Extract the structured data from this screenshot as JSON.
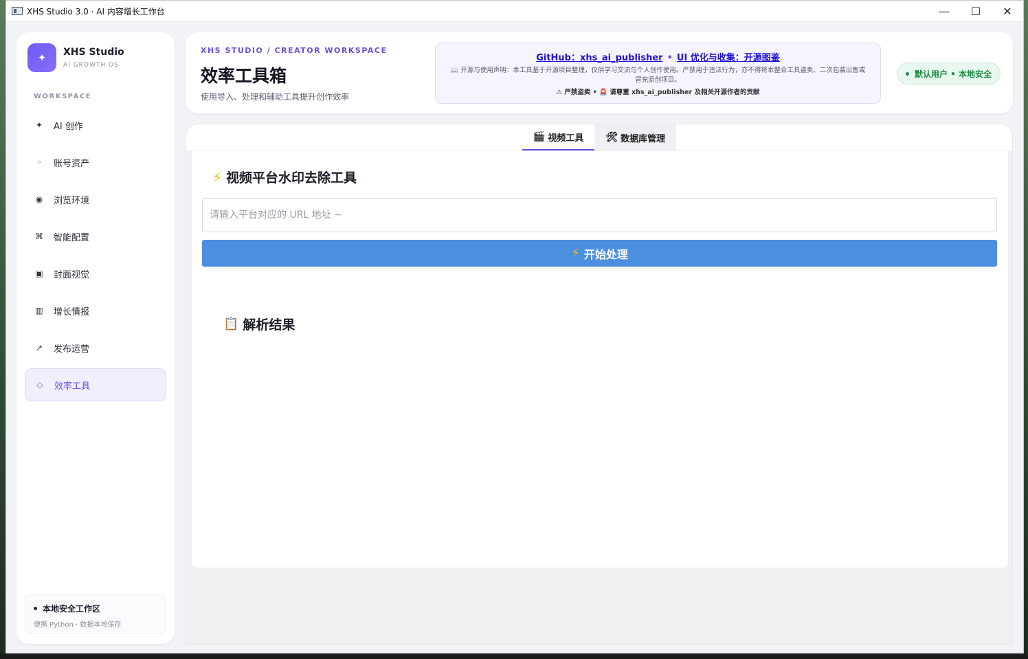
{
  "window": {
    "title": "XHS Studio 3.0 · AI 内容增长工作台",
    "minimize_glyph": "—",
    "maximize_glyph": "☐",
    "close_glyph": "✕"
  },
  "sidebar": {
    "brand_glyph": "✦",
    "brand_name": "XHS Studio",
    "brand_sub": "AI GROWTH OS",
    "section_label": "WORKSPACE",
    "items": [
      {
        "label": "AI 创作",
        "icon": "✦"
      },
      {
        "label": "账号资产",
        "icon": "◦"
      },
      {
        "label": "浏览环境",
        "icon": "◉"
      },
      {
        "label": "智能配置",
        "icon": "⌘"
      },
      {
        "label": "封面视觉",
        "icon": "▣"
      },
      {
        "label": "增长情报",
        "icon": "▥"
      },
      {
        "label": "发布运营",
        "icon": "↗"
      },
      {
        "label": "效率工具",
        "icon": "◇"
      }
    ],
    "footer_title": "本地安全工作区",
    "footer_sub": "便携 Python · 数据本地保存"
  },
  "header": {
    "eyebrow": "XHS STUDIO / CREATOR WORKSPACE",
    "title": "效率工具箱",
    "subtitle": "使用导入、处理和辅助工具提升创作效率",
    "notice": {
      "link1": "GitHub：xhs_ai_publisher",
      "separator": "•",
      "link2": "UI 优化与收集：开源图鉴",
      "description": "📖 开源与使用声明：本工具基于开源项目整理，仅供学习交流与个人创作使用。严禁用于违法行为，亦不得将本整合工具盗卖、二次包装出售或冒充原创项目。",
      "warning": "⚠ 严禁盗卖 • 🚨 请尊重 xhs_ai_publisher 及相关开源作者的贡献"
    },
    "user_badge": "默认用户 • 本地安全"
  },
  "tabs": [
    {
      "label": "视频工具",
      "icon": "🎬",
      "active": true
    },
    {
      "label": "数据库管理",
      "icon": "🛠",
      "active": false
    }
  ],
  "panel": {
    "title_icon": "⚡",
    "title": "视频平台水印去除工具",
    "input_placeholder": "请输入平台对应的 URL 地址 ~",
    "input_value": "",
    "button_icon": "⚡",
    "button_label": "开始处理",
    "result_icon": "📋",
    "result_title": "解析结果"
  }
}
